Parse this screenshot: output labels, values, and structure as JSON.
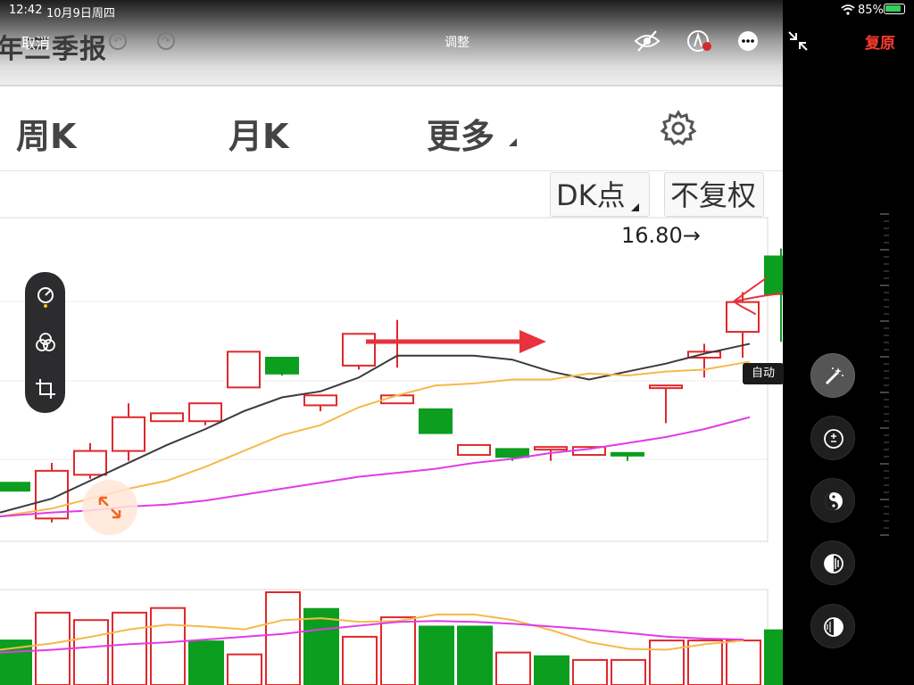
{
  "status": {
    "time": "12:42",
    "date": "10月9日周四",
    "battery": "85%"
  },
  "edit": {
    "cancel": "取消",
    "title": "调整",
    "reset": "复原",
    "auto_label": "自动"
  },
  "app": {
    "report_text": "年三季报",
    "tabs": [
      {
        "label": "周K"
      },
      {
        "label": "月K"
      },
      {
        "label": "更多"
      }
    ],
    "chip_dk": "DK点",
    "chip_fq": "不复权",
    "price_label": "16.80→"
  },
  "colors": {
    "up": "#e0282c",
    "down": "#0b9e1f",
    "ma5": "#3a3a3a",
    "ma10": "#f5b94a",
    "ma20": "#e23be8",
    "annotation": "#e8323e",
    "reset": "#ff3b30"
  },
  "chart_data": [
    {
      "type": "candlestick",
      "series": [
        {
          "name": "",
          "dir": [
            "down",
            "up",
            "up",
            "up",
            "up",
            "up",
            "up",
            "down",
            "up",
            "up",
            "up",
            "down",
            "up",
            "down",
            "up",
            "up",
            "down",
            "up",
            "up",
            "up",
            "down"
          ],
          "open": [
            15.3,
            15.12,
            15.34,
            15.46,
            15.61,
            15.61,
            15.78,
            15.93,
            15.69,
            15.89,
            15.7,
            15.67,
            15.49,
            15.47,
            15.48,
            15.44,
            15.44,
            15.79,
            15.93,
            16.06,
            16.44
          ],
          "close": [
            15.26,
            15.36,
            15.46,
            15.63,
            15.65,
            15.7,
            15.96,
            15.85,
            15.74,
            16.05,
            15.74,
            15.55,
            15.44,
            15.43,
            15.48,
            15.48,
            15.45,
            15.79,
            15.96,
            16.21,
            16.25
          ],
          "high": [
            15.3,
            15.4,
            15.5,
            15.7,
            15.65,
            15.7,
            15.96,
            15.93,
            15.74,
            16.05,
            16.12,
            15.67,
            15.49,
            15.47,
            15.48,
            15.48,
            15.45,
            15.79,
            16.0,
            16.26,
            16.48
          ],
          "low": [
            15.26,
            15.1,
            15.32,
            15.41,
            15.61,
            15.59,
            15.78,
            15.84,
            15.66,
            15.87,
            15.88,
            15.55,
            15.44,
            15.41,
            15.41,
            15.44,
            15.41,
            15.6,
            15.83,
            15.93,
            16.01
          ]
        },
        {
          "name": "",
          "values": [
            15.15,
            15.22,
            15.31,
            15.4,
            15.49,
            15.57,
            15.66,
            15.73,
            15.76,
            15.83,
            15.94,
            15.94,
            15.94,
            15.92,
            15.86,
            15.82,
            15.86,
            15.9,
            15.95,
            16.0
          ]
        },
        {
          "name": "",
          "values": [
            15.13,
            15.17,
            15.22,
            15.27,
            15.31,
            15.38,
            15.46,
            15.54,
            15.59,
            15.68,
            15.74,
            15.79,
            15.8,
            15.82,
            15.82,
            15.85,
            15.84,
            15.86,
            15.87,
            15.91
          ]
        },
        {
          "name": "",
          "values": [
            15.13,
            15.15,
            15.16,
            15.18,
            15.19,
            15.21,
            15.24,
            15.27,
            15.3,
            15.33,
            15.35,
            15.37,
            15.4,
            15.42,
            15.45,
            15.47,
            15.5,
            15.53,
            15.57,
            15.63
          ]
        }
      ]
    },
    {
      "type": "bar",
      "series": [
        {
          "name": "",
          "dir": [
            "down",
            "up",
            "up",
            "up",
            "up",
            "down",
            "up",
            "up",
            "down",
            "up",
            "up",
            "down",
            "down",
            "up",
            "down",
            "up",
            "up",
            "up",
            "up",
            "up",
            "down"
          ],
          "values": [
            48,
            78,
            70,
            78,
            83,
            47,
            33,
            100,
            82,
            52,
            73,
            63,
            63,
            35,
            31,
            27,
            27,
            48,
            48,
            48,
            59
          ]
        },
        {
          "name": "",
          "values": [
            38,
            45,
            52,
            60,
            65,
            63,
            60,
            70,
            72,
            68,
            69,
            76,
            76,
            70,
            59,
            46,
            39,
            38,
            44,
            48
          ]
        },
        {
          "name": "",
          "values": [
            35,
            38,
            41,
            44,
            46,
            49,
            52,
            55,
            60,
            64,
            68,
            69,
            68,
            66,
            63,
            60,
            56,
            52,
            50,
            49
          ]
        }
      ]
    }
  ]
}
